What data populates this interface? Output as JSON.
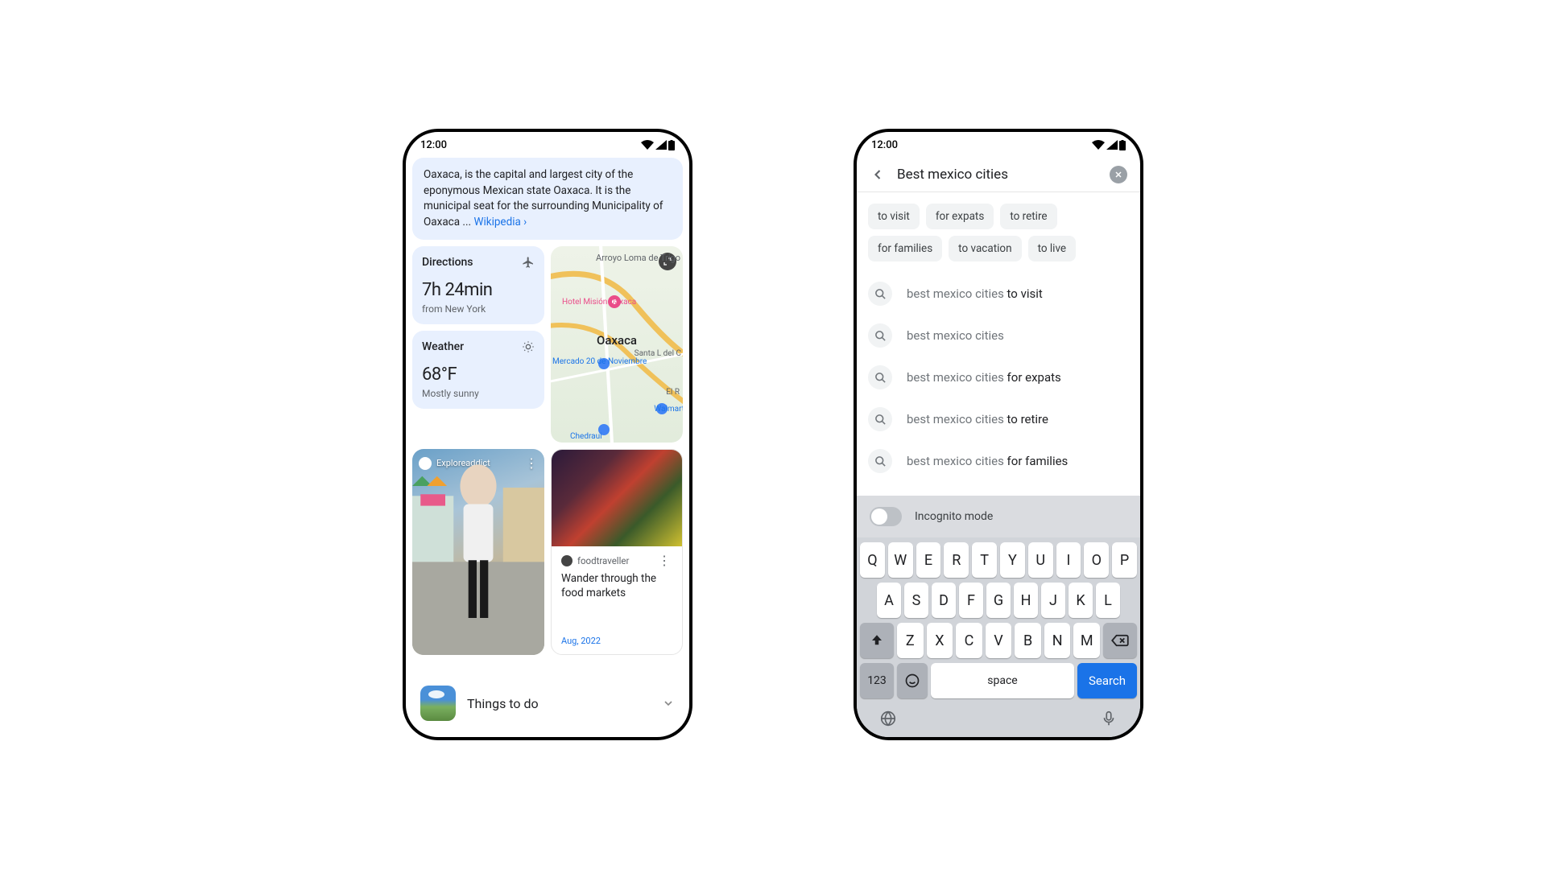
{
  "status": {
    "time": "12:00"
  },
  "phone1": {
    "info_text": "Oaxaca, is the capital and largest city of the eponymous Mexican state Oaxaca. It is the municipal seat for the surrounding Municipality of Oaxaca ... ",
    "info_link": "Wikipedia ›",
    "directions": {
      "label": "Directions",
      "value": "7h 24min",
      "sub": "from New York"
    },
    "weather": {
      "label": "Weather",
      "value": "68°F",
      "sub": "Mostly sunny"
    },
    "map": {
      "center": "Oaxaca",
      "poi1": "Arroyo Loma de Trigo",
      "poi2": "Hotel Misión Oaxaca",
      "poi3": "Mercado 20 de Noviembre",
      "poi4": "Santa L del C",
      "poi5": "El R",
      "poi6": "Walmart",
      "poi7": "Chedraui"
    },
    "story": {
      "author": "Exploreaddict"
    },
    "article": {
      "author": "foodtraveller",
      "title": "Wander through the food markets",
      "date": "Aug, 2022"
    },
    "bottom_chip": "Things to do"
  },
  "phone2": {
    "query": "Best mexico cities",
    "chips": [
      "to visit",
      "for expats",
      "to retire",
      "for families",
      "to vacation",
      "to live"
    ],
    "suggestions": [
      {
        "base": "best mexico cities ",
        "bold": "to visit"
      },
      {
        "base": "best mexico cities",
        "bold": ""
      },
      {
        "base": "best mexico cities ",
        "bold": "for expats"
      },
      {
        "base": "best mexico cities ",
        "bold": "to retire"
      },
      {
        "base": "best mexico cities ",
        "bold": "for families"
      }
    ],
    "incognito_label": "Incognito mode",
    "keyboard": {
      "row1": [
        "Q",
        "W",
        "E",
        "R",
        "T",
        "Y",
        "U",
        "I",
        "O",
        "P"
      ],
      "row2": [
        "A",
        "S",
        "D",
        "F",
        "G",
        "H",
        "J",
        "K",
        "L"
      ],
      "row3": [
        "Z",
        "X",
        "C",
        "V",
        "B",
        "N",
        "M"
      ],
      "num_key": "123",
      "space": "space",
      "search": "Search"
    }
  }
}
